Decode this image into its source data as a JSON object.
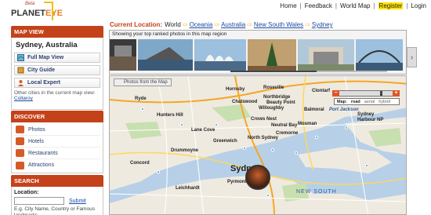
{
  "header": {
    "logo_beta": "Beta",
    "logo_name_a": "PLANET",
    "logo_name_b": "EYE",
    "nav": [
      "Home",
      "Feedback",
      "World Map",
      "Register",
      "Login"
    ]
  },
  "sidebar": {
    "map_view": {
      "title": "MAP VIEW",
      "city": "Sydney, Australia",
      "buttons": [
        "Full Map View",
        "City Guide",
        "Local Expert"
      ],
      "other_text": "Other cities in the current map view:",
      "other_link": "Collaroy"
    },
    "discover": {
      "title": "DISCOVER",
      "items": [
        "Photos",
        "Hotels",
        "Restaurants",
        "Attractions"
      ]
    },
    "search": {
      "title": "SEARCH",
      "label": "Location:",
      "submit": "Submit",
      "hint": "E.g. City Name, Country or Famous landmarks."
    }
  },
  "breadcrumb": {
    "label": "Current Location:",
    "root": "World",
    "items": [
      "Oceania",
      "Australia",
      "New South Wales",
      "Sydney"
    ]
  },
  "photos": {
    "caption": "Showing your top ranked photos in this map region"
  },
  "map": {
    "photos_tab": "Photos from the Map",
    "map_label": "Map:",
    "modes": [
      "road",
      "aerial",
      "hybrid"
    ],
    "selected_mode": "road",
    "labels": {
      "ryde": "Ryde",
      "hunters_hill": "Hunters Hill",
      "drummoyne": "Drummoyne",
      "concord": "Concord",
      "leichhardt": "Leichhardt",
      "lane_cove": "Lane Cove",
      "greenwich": "Greenwich",
      "hornsby": "Hornsby",
      "roseville": "Roseville",
      "chatswood": "Chatswood",
      "willoughby": "Willoughby",
      "northbridge": "Northbridge",
      "beauty_point": "Beauty Point",
      "crows_nest": "Crows Nest",
      "neutral_bay": "Neutral Bay",
      "mosman": "Mosman",
      "north_sydney": "North Sydney",
      "cremorne": "Cremorne",
      "clontarf": "Clontarf",
      "balmoral": "Balmoral",
      "port_jackson": "Port Jackson",
      "sydney_harbour_np": "Sydney Harbour NP",
      "sydney": "Sydn",
      "new_south_wales": "NEW SOUTH",
      "pyrmont": "Pyrmont"
    }
  },
  "colors": {
    "accent": "#c4421a",
    "link": "#1a4aa0",
    "highlight": "#ffe500",
    "water": "#b7d0e8",
    "land": "#f0ece3"
  }
}
